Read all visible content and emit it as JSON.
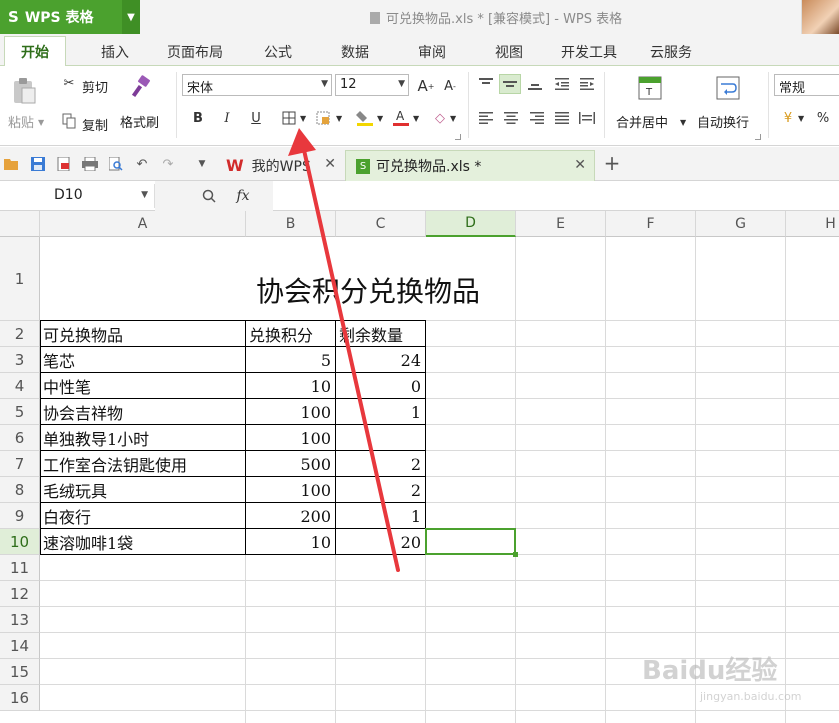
{
  "app": {
    "name": "WPS 表格",
    "logo_glyph": "S",
    "window_title": "可兑换物品.xls * [兼容模式] - WPS 表格"
  },
  "ribbon_tabs": [
    "开始",
    "插入",
    "页面布局",
    "公式",
    "数据",
    "审阅",
    "视图",
    "开发工具",
    "云服务"
  ],
  "ribbon": {
    "paste_label": "粘贴",
    "cut_label": "剪切",
    "copy_label": "复制",
    "format_painter_label": "格式刷",
    "font_name": "宋体",
    "font_size": "12",
    "bold": "B",
    "italic": "I",
    "underline": "U",
    "merge_center_label": "合并居中",
    "wrap_text_label": "自动换行",
    "number_format": "常规",
    "percent_glyph": "%"
  },
  "doc_tabs": [
    {
      "label": "我的WPS",
      "active": false
    },
    {
      "label": "可兑换物品.xls *",
      "active": true
    }
  ],
  "formula_bar": {
    "name_box": "D10",
    "fx_label": "fx",
    "content": ""
  },
  "sheet": {
    "columns": [
      "A",
      "B",
      "C",
      "D",
      "E",
      "F",
      "G",
      "H"
    ],
    "rows": [
      "1",
      "2",
      "3",
      "4",
      "5",
      "6",
      "7",
      "8",
      "9",
      "10",
      "11",
      "12",
      "13",
      "14",
      "15",
      "16"
    ],
    "selected_cell": "D10",
    "title": "协会积分兑换物品",
    "headers": [
      "可兑换物品",
      "兑换积分",
      "剩余数量"
    ],
    "data": [
      [
        "笔芯",
        "5",
        "24"
      ],
      [
        "中性笔",
        "10",
        "0"
      ],
      [
        "协会吉祥物",
        "100",
        "1"
      ],
      [
        "单独教导1小时",
        "100",
        ""
      ],
      [
        "工作室合法钥匙使用",
        "500",
        "2"
      ],
      [
        "毛绒玩具",
        "100",
        "2"
      ],
      [
        "白夜行",
        "200",
        "1"
      ],
      [
        "速溶咖啡1袋",
        "10",
        "20"
      ]
    ]
  },
  "watermark": {
    "brand": "Baidu经验",
    "url": "jingyan.baidu.com"
  },
  "colors": {
    "accent": "#4ba12e",
    "arrow": "#e8383d"
  }
}
